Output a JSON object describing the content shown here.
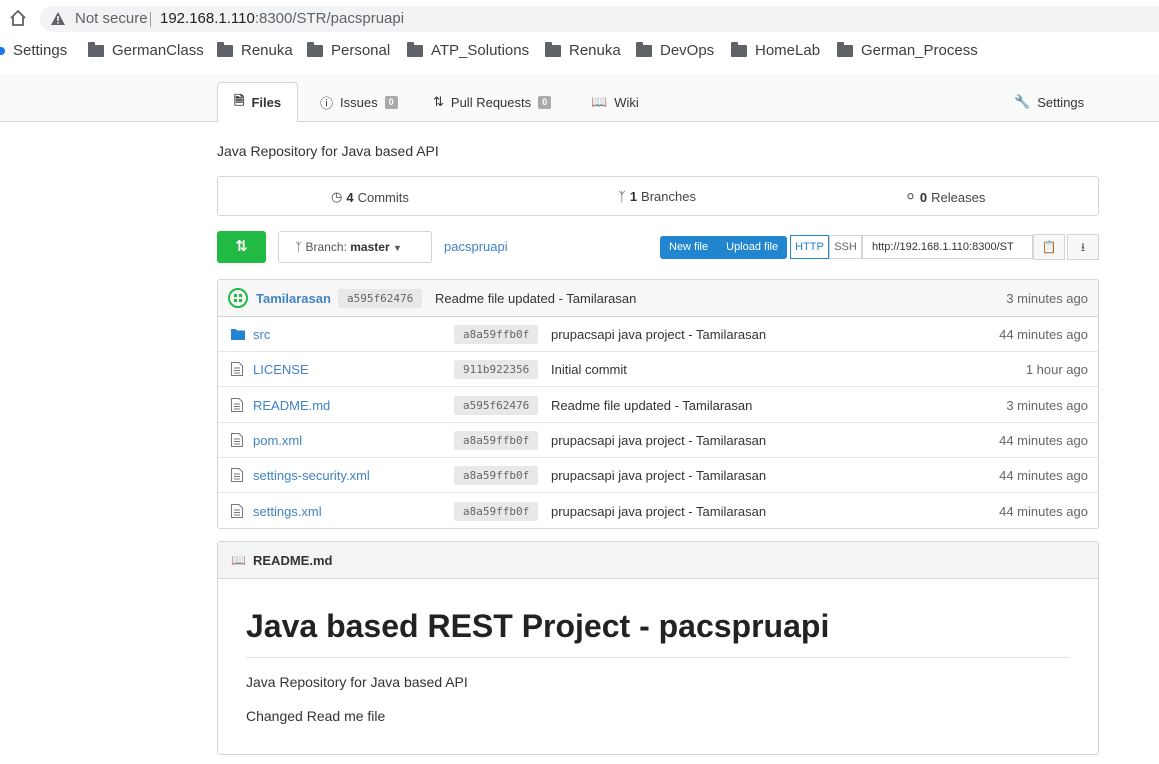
{
  "browser": {
    "security_label": "Not secure",
    "url_host": "192.168.1.110",
    "url_path": ":8300/STR/pacspruapi",
    "bookmarks": [
      "Settings",
      "GermanClass",
      "Renuka",
      "Personal",
      "ATP_Solutions",
      "Renuka",
      "DevOps",
      "HomeLab",
      "German_Process"
    ]
  },
  "repo_nav": {
    "tabs": [
      {
        "label": "Files",
        "icon": "file-text-icon"
      },
      {
        "label": "Issues",
        "icon": "issue-opened-icon",
        "badge": "0"
      },
      {
        "label": "Pull Requests",
        "icon": "git-pull-request-icon",
        "badge": "0"
      },
      {
        "label": "Wiki",
        "icon": "book-icon"
      }
    ],
    "settings_label": "Settings"
  },
  "description": "Java Repository for Java based API",
  "stats": {
    "commits_count": "4",
    "commits_label": "Commits",
    "branches_count": "1",
    "branches_label": "Branches",
    "releases_count": "0",
    "releases_label": "Releases"
  },
  "toolbar": {
    "branch_prefix": "Branch:",
    "branch_name": "master",
    "repo_crumb": "pacspruapi",
    "new_file": "New file",
    "upload_file": "Upload file",
    "http": "HTTP",
    "ssh": "SSH",
    "clone_url": "http://192.168.1.110:8300/ST"
  },
  "latest_commit": {
    "author": "Tamilarasan",
    "sha": "a595f62476",
    "message": "Readme file updated - Tamilarasan",
    "age": "3 minutes ago"
  },
  "files": [
    {
      "name": "src",
      "type": "folder",
      "sha": "a8a59ffb0f",
      "message": "prupacsapi java project - Tamilarasan",
      "age": "44 minutes ago"
    },
    {
      "name": "LICENSE",
      "type": "file",
      "sha": "911b922356",
      "message": "Initial commit",
      "age": "1 hour ago"
    },
    {
      "name": "README.md",
      "type": "file",
      "sha": "a595f62476",
      "message": "Readme file updated - Tamilarasan",
      "age": "3 minutes ago"
    },
    {
      "name": "pom.xml",
      "type": "file",
      "sha": "a8a59ffb0f",
      "message": "prupacsapi java project - Tamilarasan",
      "age": "44 minutes ago"
    },
    {
      "name": "settings-security.xml",
      "type": "file",
      "sha": "a8a59ffb0f",
      "message": "prupacsapi java project - Tamilarasan",
      "age": "44 minutes ago"
    },
    {
      "name": "settings.xml",
      "type": "file",
      "sha": "a8a59ffb0f",
      "message": "prupacsapi java project - Tamilarasan",
      "age": "44 minutes ago"
    }
  ],
  "readme": {
    "filename": "README.md",
    "heading": "Java based REST Project - pacspruapi",
    "para1": "Java Repository for Java based API",
    "para2": "Changed Read me file"
  },
  "colors": {
    "accent": "#4183c4",
    "green": "#21ba45",
    "blue": "#2185d0"
  }
}
